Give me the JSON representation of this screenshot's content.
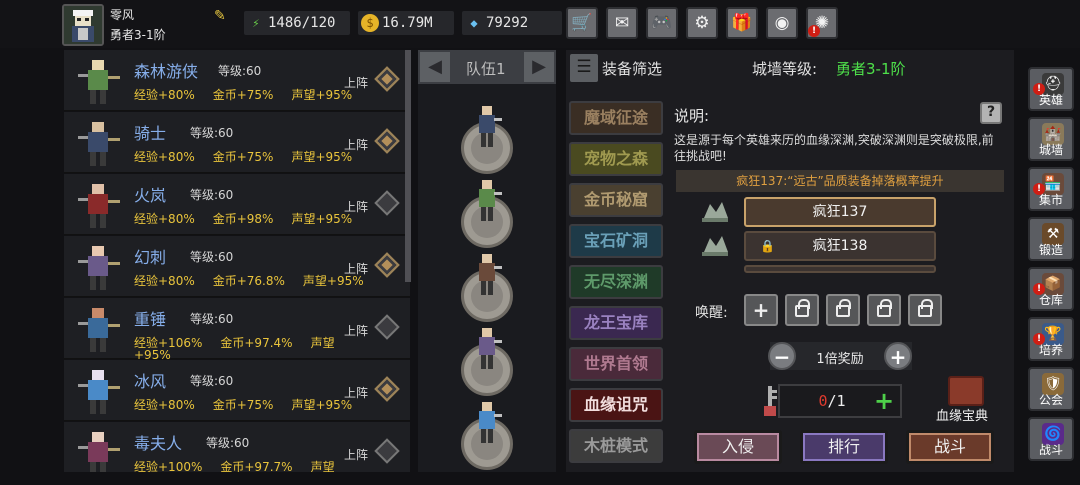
{
  "player": {
    "name": "零风",
    "rank": "勇者3-1阶"
  },
  "resources": {
    "energy": "1486/120",
    "gold": "16.79M",
    "gems": "79292"
  },
  "top_buttons": [
    {
      "name": "shop-cart-icon",
      "glyph": "🛒"
    },
    {
      "name": "mail-icon",
      "glyph": "✉"
    },
    {
      "name": "gamepad-icon",
      "glyph": "🎮"
    },
    {
      "name": "settings-gear-icon",
      "glyph": "⚙"
    },
    {
      "name": "gift-icon",
      "glyph": "🎁"
    },
    {
      "name": "color-wheel-icon",
      "glyph": "◉"
    },
    {
      "name": "fireworks-icon",
      "glyph": "✺"
    }
  ],
  "heroes": [
    {
      "name": "森林游侠",
      "level_label": "等级:60",
      "deploy": "上阵",
      "deployed": true,
      "stats": [
        "经验+80%",
        "金币+75%",
        "声望+95%"
      ]
    },
    {
      "name": "骑士",
      "level_label": "等级:60",
      "deploy": "上阵",
      "deployed": true,
      "stats": [
        "经验+80%",
        "金币+75%",
        "声望+95%"
      ]
    },
    {
      "name": "火岚",
      "level_label": "等级:60",
      "deploy": "上阵",
      "deployed": false,
      "stats": [
        "经验+80%",
        "金币+98%",
        "声望+95%"
      ]
    },
    {
      "name": "幻刺",
      "level_label": "等级:60",
      "deploy": "上阵",
      "deployed": true,
      "stats": [
        "经验+80%",
        "金币+76.8%",
        "声望+95%"
      ]
    },
    {
      "name": "重锤",
      "level_label": "等级:60",
      "deploy": "上阵",
      "deployed": false,
      "stats": [
        "经验+106%",
        "金币+97.4%",
        "声望",
        "+95%"
      ]
    },
    {
      "name": "冰风",
      "level_label": "等级:60",
      "deploy": "上阵",
      "deployed": true,
      "stats": [
        "经验+80%",
        "金币+75%",
        "声望+95%"
      ]
    },
    {
      "name": "毒夫人",
      "level_label": "等级:60",
      "deploy": "上阵",
      "deployed": false,
      "stats": [
        "经验+100%",
        "金币+97.7%",
        "声望"
      ]
    }
  ],
  "team": {
    "title": "队伍1"
  },
  "filter": {
    "label": "装备筛选"
  },
  "wall": {
    "label": "城墙等级:",
    "value": "勇者3-1阶"
  },
  "modes": [
    {
      "label": "魔域征途",
      "bg": "#3a2e24",
      "fg": "#9a8060"
    },
    {
      "label": "宠物之森",
      "bg": "#4a4a20",
      "fg": "#a09a50"
    },
    {
      "label": "金币秘窟",
      "bg": "#4a4030",
      "fg": "#b09a70"
    },
    {
      "label": "宝石矿洞",
      "bg": "#1e3a48",
      "fg": "#6aa0b8"
    },
    {
      "label": "无尽深渊",
      "bg": "#1f3a28",
      "fg": "#5e9a6a"
    },
    {
      "label": "龙王宝库",
      "bg": "#3a2850",
      "fg": "#9a82c0"
    },
    {
      "label": "世界首领",
      "bg": "#4a2a3a",
      "fg": "#b07a90"
    },
    {
      "label": "血缘诅咒",
      "bg": "#4a1414",
      "fg": "#f2dede"
    },
    {
      "label": "木桩模式",
      "bg": "#3c3c3c",
      "fg": "#9a9a9a"
    }
  ],
  "description": {
    "title": "说明:",
    "text": "这是源于每个英雄来历的血缘深渊,突破深渊则是突破极限,前往挑战吧!",
    "bonus": "疯狂137:“远古”品质装备掉落概率提升"
  },
  "levels": [
    {
      "label": "疯狂137",
      "locked": false
    },
    {
      "label": "疯狂138",
      "locked": true
    }
  ],
  "awaken": {
    "label": "唤醒:",
    "slots": 5
  },
  "reward": {
    "label": "1倍奖励"
  },
  "tickets": {
    "current": "0",
    "max": "/1"
  },
  "codex": {
    "label": "血缘宝典"
  },
  "actions": [
    {
      "label": "入侵",
      "bg": "#6a4a56",
      "border": "#b98aa0"
    },
    {
      "label": "排行",
      "bg": "#4a3a6a",
      "border": "#8a78c0"
    },
    {
      "label": "战斗",
      "bg": "#6a3a2a",
      "border": "#c08a6a"
    }
  ],
  "sidebar": [
    {
      "label": "英雄",
      "icon": "hero-helmet-icon",
      "alert": true
    },
    {
      "label": "城墙",
      "icon": "castle-wall-icon",
      "alert": false
    },
    {
      "label": "集市",
      "icon": "market-icon",
      "alert": true
    },
    {
      "label": "锻造",
      "icon": "anvil-icon",
      "alert": false
    },
    {
      "label": "仓库",
      "icon": "warehouse-icon",
      "alert": true
    },
    {
      "label": "培养",
      "icon": "training-trophy-icon",
      "alert": true
    },
    {
      "label": "公会",
      "icon": "guild-icon",
      "alert": false
    },
    {
      "label": "战斗",
      "icon": "battle-portal-icon",
      "alert": false
    }
  ]
}
